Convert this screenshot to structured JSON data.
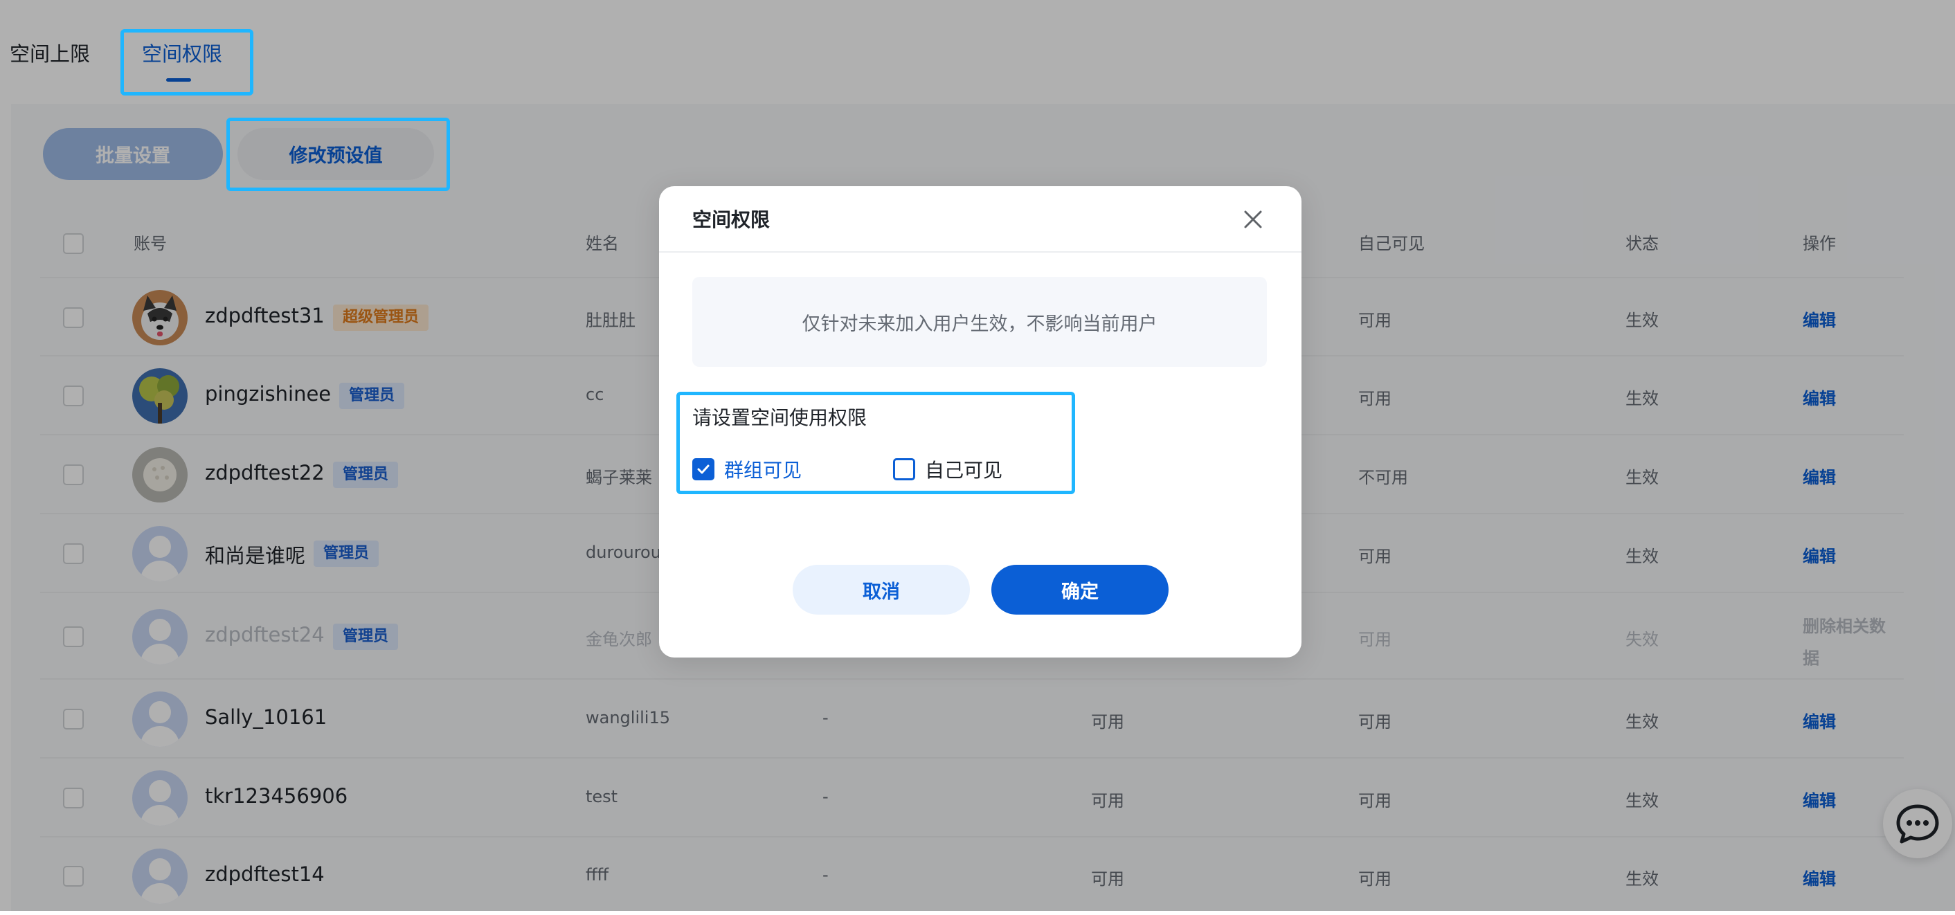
{
  "tabs": [
    {
      "label": "空间上限"
    },
    {
      "label": "空间权限",
      "active": true
    }
  ],
  "toolbar": {
    "batch_label": "批量设置",
    "preset_label": "修改预设值"
  },
  "table": {
    "headers": {
      "account": "账号",
      "name": "姓名",
      "self_visible": "自己可见",
      "status": "状态",
      "action": "操作"
    },
    "rows": [
      {
        "account": "zdpdftest31",
        "badge": "超级管理员",
        "badge_type": "super",
        "name": "肚肚肚",
        "col3": "",
        "col4": "",
        "self_visible": "可用",
        "status": "生效",
        "action": "编辑",
        "avatar": "husky"
      },
      {
        "account": "pingzishinee",
        "badge": "管理员",
        "badge_type": "admin",
        "name": "cc",
        "col3": "",
        "col4": "",
        "self_visible": "可用",
        "status": "生效",
        "action": "编辑",
        "avatar": "tree"
      },
      {
        "account": "zdpdftest22",
        "badge": "管理员",
        "badge_type": "admin",
        "name": "蝎子莱莱",
        "col3": "",
        "col4": "",
        "self_visible": "不可用",
        "status": "生效",
        "action": "编辑",
        "avatar": "ball"
      },
      {
        "account": "和尚是谁呢",
        "badge": "管理员",
        "badge_type": "admin",
        "name": "durourou",
        "col3": "",
        "col4": "",
        "self_visible": "可用",
        "status": "生效",
        "action": "编辑",
        "avatar": "default"
      },
      {
        "account": "zdpdftest24",
        "badge": "管理员",
        "badge_type": "admin",
        "name": "金龟次郎",
        "col3": "",
        "col4": "",
        "self_visible": "可用",
        "status": "失效",
        "action": "删除相关数据",
        "avatar": "default",
        "disabled": true
      },
      {
        "account": "Sally_10161",
        "badge": "",
        "badge_type": "",
        "name": "wanglili15",
        "col3": "-",
        "col4": "可用",
        "self_visible": "可用",
        "status": "生效",
        "action": "编辑",
        "avatar": "default"
      },
      {
        "account": "tkr123456906",
        "badge": "",
        "badge_type": "",
        "name": "test",
        "col3": "-",
        "col4": "可用",
        "self_visible": "可用",
        "status": "生效",
        "action": "编辑",
        "avatar": "default"
      },
      {
        "account": "zdpdftest14",
        "badge": "",
        "badge_type": "",
        "name": "ffff",
        "col3": "-",
        "col4": "可用",
        "self_visible": "可用",
        "status": "生效",
        "action": "编辑",
        "avatar": "default"
      }
    ]
  },
  "modal": {
    "title": "空间权限",
    "notice": "仅针对未来加入用户生效，不影响当前用户",
    "perm_label": "请设置空间使用权限",
    "options": [
      {
        "label": "群组可见",
        "checked": true
      },
      {
        "label": "自己可见",
        "checked": false
      }
    ],
    "cancel_label": "取消",
    "ok_label": "确定"
  },
  "colors": {
    "accent": "#0b5fd6",
    "highlight_box": "#1fb6ff",
    "super_badge": "#e07b1c",
    "admin_badge": "#1a5fcf"
  },
  "icons": {
    "close": "close-icon",
    "check": "check-icon",
    "chat": "chat-bubble-icon"
  }
}
